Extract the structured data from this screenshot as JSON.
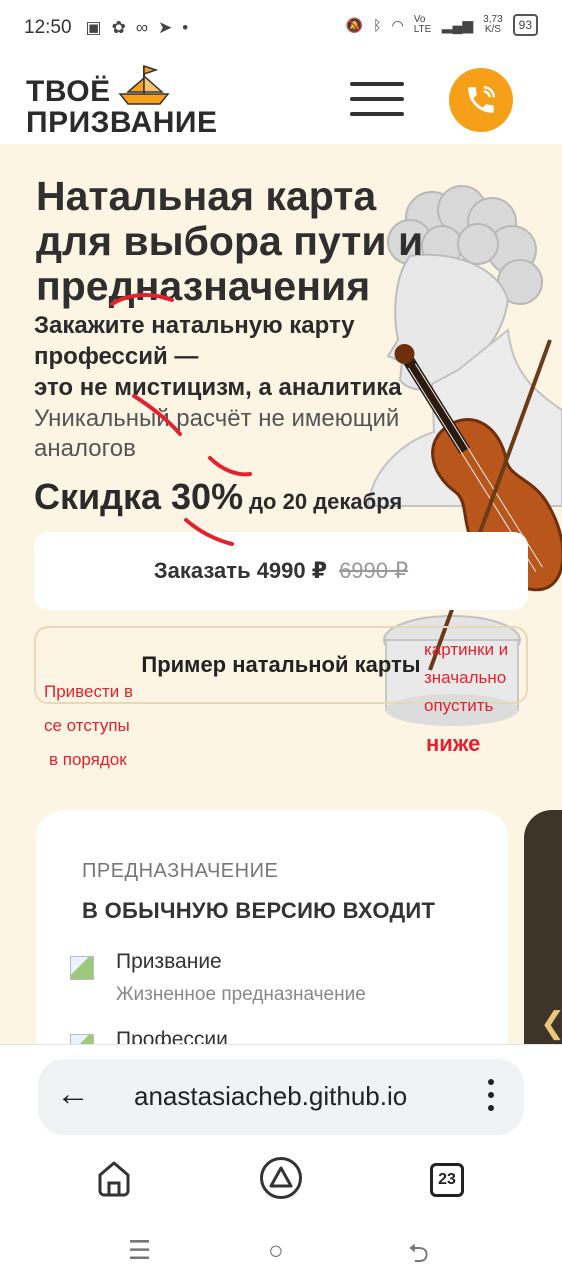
{
  "status_bar": {
    "time": "12:50",
    "network_speed": "3,73",
    "network_unit": "K/S",
    "network_type": "Vo LTE",
    "battery": "93"
  },
  "header": {
    "logo_line1": "ТВОЁ",
    "logo_line2": "ПРИЗВАНИЕ",
    "menu_icon": "hamburger-icon",
    "call_icon": "phone-icon",
    "accent_color": "#f6a01a"
  },
  "hero": {
    "title": "Натальная карта для выбора пути и предназначения",
    "subtitle_line1": "Закажите натальную карту",
    "subtitle_line2": "профессий —",
    "subtitle_line3": "это не мистицизм, а аналитика",
    "description": "Уникальный расчёт не имеющий аналогов",
    "discount_label": "Скидка 30%",
    "discount_until": "до 20 декабря",
    "order_label": "Заказать 4990 ₽",
    "order_old_price": "6990 ₽",
    "example_label": "Пример натальной карты"
  },
  "annotations": {
    "left_note_1": "Привести в",
    "left_note_2": "се отступы",
    "left_note_3": "в порядок",
    "right_note_1": "картинки и",
    "right_note_2": "значально",
    "right_note_3": "опустить",
    "right_note_4": "ниже",
    "note_color": "#e3222e"
  },
  "card": {
    "kicker": "ПРЕДНАЗНАЧЕНИЕ",
    "title": "В ОБЫЧНУЮ ВЕРСИЮ ВХОДИТ",
    "items": [
      {
        "name": "Призвание",
        "desc": "Жизненное предназначение"
      },
      {
        "name": "Профессии",
        "desc": ""
      }
    ]
  },
  "browser": {
    "url": "anastasiacheb.github.io",
    "tabs_count": "23"
  }
}
